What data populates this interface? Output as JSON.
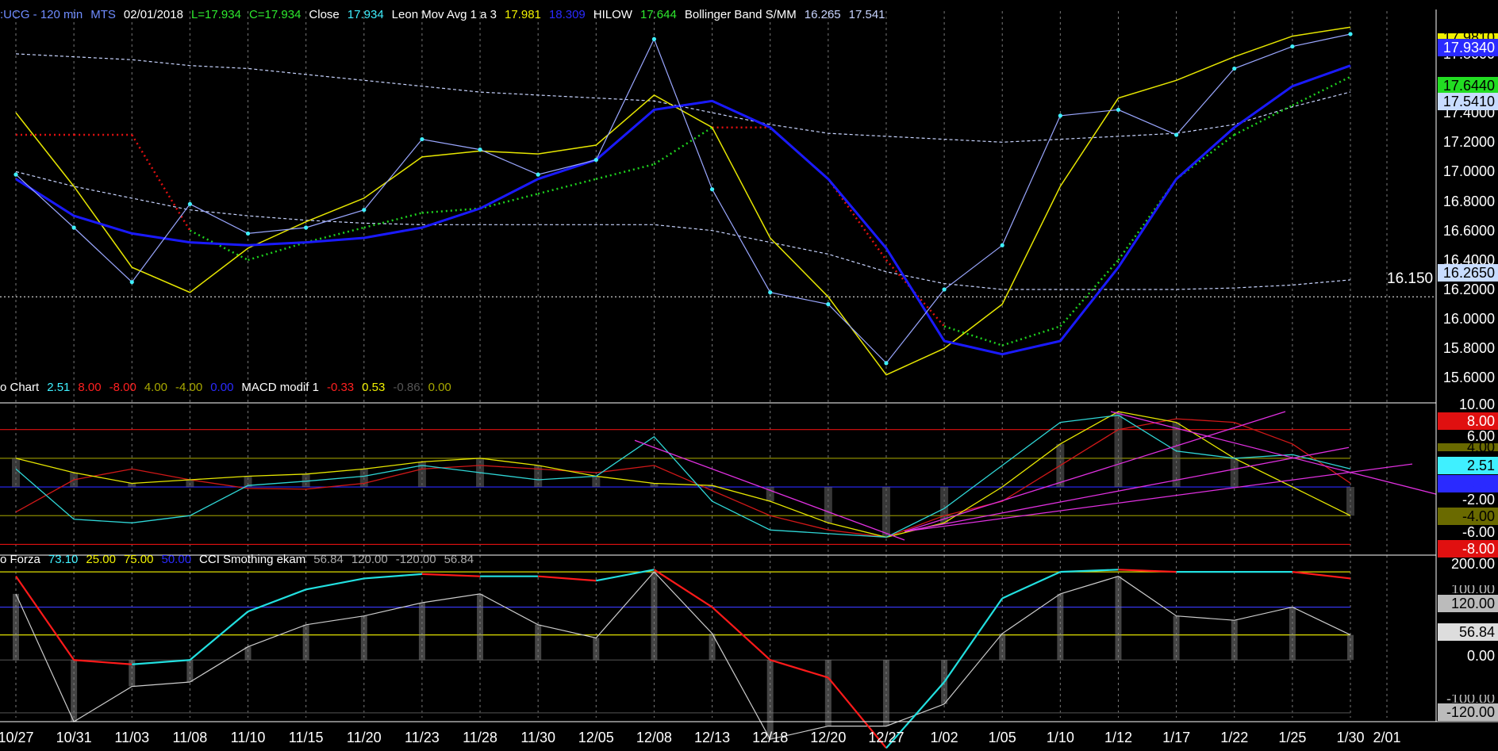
{
  "header_main": {
    "symbol": ":UCG - 120 min",
    "source": "MTS",
    "date": "02/01/2018",
    "low": "L=17.934",
    "close_eq": "C=17.934",
    "close_label": "Close",
    "close_value": "17.934",
    "mov_avg_label": "Leon Mov Avg 1 a 3",
    "mov_avg_v1": "17.981",
    "mov_avg_v2": "18.309",
    "hilow_label": "HILOW",
    "hilow_value": "17.644",
    "bb_label": "Bollinger Band S/MM",
    "bb_v1": "16.265",
    "bb_v2": "17.541"
  },
  "header_macd": {
    "chart_label": "o Chart",
    "v1": "2.51",
    "v2": "8.00",
    "v3": "-8.00",
    "v4": "4.00",
    "v5": "-4.00",
    "v6": "0.00",
    "macd_label": "MACD modif 1",
    "m1": "-0.33",
    "m2": "0.53",
    "m3": "-0.86",
    "m4": "0.00"
  },
  "header_cci": {
    "forza_label": "o Forza",
    "f1": "73.10",
    "f2": "25.00",
    "f3": "75.00",
    "f4": "50.00",
    "cci_label": "CCI Smothing ekam",
    "c1": "56.84",
    "c2": "120.00",
    "c3": "-120.00",
    "c4": "56.84"
  },
  "price_scale": {
    "ticks": [
      "17.8000",
      "17.6000",
      "17.4000",
      "17.2000",
      "17.0000",
      "16.8000",
      "16.6000",
      "16.4000",
      "16.2000",
      "16.0000",
      "15.8000",
      "15.6000"
    ],
    "top_tag": "17.9810",
    "close_tag": "17.9340",
    "hilow_tag": "17.6440",
    "bb_upper_tag": "17.5410",
    "bb_lower_tag": "16.2650",
    "ref_line_label": "16.150"
  },
  "macd_scale": {
    "ticks": [
      "10.00",
      "6.00",
      "-2.00",
      "-6.00"
    ],
    "tag_8": "8.00",
    "tag_4": "4.00",
    "tag_251": "2.51",
    "tag_0": "0.00",
    "tag_m4": "-4.00",
    "tag_m8": "-8.00"
  },
  "cci_scale": {
    "ticks": [
      "200.00",
      "0.00"
    ],
    "tag_120": "120.00",
    "tag_100": "100.00",
    "tag_5684": "56.84",
    "tag_m100": "-100.00",
    "tag_m120": "-120.00"
  },
  "x_axis": {
    "labels": [
      "10/27",
      "10/31",
      "11/03",
      "11/08",
      "11/10",
      "11/15",
      "11/20",
      "11/23",
      "11/28",
      "11/30",
      "12/05",
      "12/08",
      "12/13",
      "12/18",
      "12/20",
      "12/27",
      "1/02",
      "1/05",
      "1/10",
      "1/12",
      "1/17",
      "1/22",
      "1/25",
      "1/30",
      "2/01"
    ]
  },
  "colors": {
    "price_line": "#9aa7ff",
    "dots": "#3ff0ff",
    "ma_yellow": "#e6e600",
    "ma_blue": "#1a1aff",
    "hilow_green": "#1ed21e",
    "hilow_red": "#e01010",
    "bb": "#c8d4ff",
    "macd_cyan": "#2fd6d6",
    "trend_magenta": "#e030e0",
    "cci_red": "#ff1a1a",
    "cci_cyan": "#22e0e0"
  },
  "chart_data": [
    {
      "type": "line",
      "panel": "price",
      "x": [
        "10/27",
        "10/31",
        "11/03",
        "11/08",
        "11/10",
        "11/15",
        "11/20",
        "11/23",
        "11/28",
        "11/30",
        "12/05",
        "12/08",
        "12/13",
        "12/18",
        "12/20",
        "12/27",
        "1/02",
        "1/05",
        "1/10",
        "1/12",
        "1/17",
        "1/22",
        "1/25",
        "1/30"
      ],
      "series": [
        {
          "name": "Close",
          "values": [
            16.98,
            16.62,
            16.25,
            16.78,
            16.58,
            16.62,
            16.74,
            17.22,
            17.15,
            16.98,
            17.08,
            17.9,
            16.88,
            16.18,
            16.1,
            15.7,
            16.2,
            16.5,
            17.38,
            17.42,
            17.25,
            17.7,
            17.85,
            17.934
          ]
        },
        {
          "name": "Leon Mov Avg 1 a 3",
          "values": [
            17.4,
            16.9,
            16.35,
            16.18,
            16.48,
            16.66,
            16.82,
            17.1,
            17.14,
            17.12,
            17.18,
            17.52,
            17.3,
            16.55,
            16.15,
            15.62,
            15.8,
            16.1,
            16.9,
            17.5,
            17.62,
            17.78,
            17.92,
            17.981
          ]
        },
        {
          "name": "Bollinger Band S/MM",
          "values": [
            16.95,
            16.7,
            16.58,
            16.52,
            16.5,
            16.52,
            16.55,
            16.62,
            16.75,
            16.95,
            17.08,
            17.42,
            17.48,
            17.3,
            16.95,
            16.48,
            15.85,
            15.76,
            15.85,
            16.35,
            16.95,
            17.3,
            17.58,
            17.72
          ]
        },
        {
          "name": "HILOW",
          "values": [
            17.25,
            17.25,
            17.25,
            16.6,
            16.4,
            16.52,
            16.62,
            16.72,
            16.75,
            16.85,
            16.95,
            17.05,
            17.3,
            17.3,
            16.95,
            16.4,
            15.95,
            15.82,
            15.95,
            16.4,
            16.95,
            17.25,
            17.45,
            17.644
          ]
        },
        {
          "name": "BB upper",
          "values": [
            17.8,
            17.78,
            17.76,
            17.72,
            17.7,
            17.66,
            17.62,
            17.58,
            17.54,
            17.52,
            17.5,
            17.48,
            17.4,
            17.32,
            17.26,
            17.24,
            17.22,
            17.2,
            17.22,
            17.24,
            17.26,
            17.32,
            17.44,
            17.541
          ]
        },
        {
          "name": "BB lower",
          "values": [
            17.0,
            16.9,
            16.82,
            16.74,
            16.7,
            16.67,
            16.65,
            16.64,
            16.64,
            16.64,
            16.64,
            16.64,
            16.6,
            16.52,
            16.44,
            16.32,
            16.24,
            16.2,
            16.2,
            16.2,
            16.2,
            16.21,
            16.23,
            16.265
          ]
        }
      ],
      "ylim": [
        15.5,
        17.95
      ],
      "reference_line": 16.15
    },
    {
      "type": "line",
      "panel": "macd",
      "x": [
        "10/27",
        "10/31",
        "11/03",
        "11/08",
        "11/10",
        "11/15",
        "11/20",
        "11/23",
        "11/28",
        "11/30",
        "12/05",
        "12/08",
        "12/13",
        "12/18",
        "12/20",
        "12/27",
        "1/02",
        "1/05",
        "1/10",
        "1/12",
        "1/17",
        "1/22",
        "1/25",
        "1/30"
      ],
      "series": [
        {
          "name": "Chart",
          "values": [
            2.5,
            -4.5,
            -5.0,
            -4.0,
            0.2,
            0.8,
            1.5,
            3.0,
            2.0,
            1.0,
            1.5,
            7.0,
            -2.0,
            -6.0,
            -6.5,
            -7.0,
            -3.0,
            3.0,
            9.0,
            10.0,
            5.0,
            4.0,
            4.5,
            2.51
          ]
        },
        {
          "name": "MACD modif 1",
          "values": [
            -3.5,
            1.0,
            2.5,
            1.0,
            -0.2,
            -0.3,
            0.5,
            2.5,
            3.0,
            2.5,
            2.0,
            3.0,
            -0.5,
            -4.0,
            -6.0,
            -7.0,
            -4.0,
            -2.0,
            3.0,
            8.0,
            9.5,
            9.0,
            6.0,
            0.53
          ]
        },
        {
          "name": "signal",
          "values": [
            4.0,
            2.0,
            0.5,
            1.0,
            1.5,
            1.8,
            2.5,
            3.5,
            4.0,
            3.0,
            1.5,
            0.5,
            0.2,
            -2.0,
            -5.0,
            -7.0,
            -5.0,
            0.0,
            6.0,
            10.5,
            9.0,
            4.0,
            0.0,
            -4.0
          ]
        }
      ],
      "levels": [
        8,
        4,
        0,
        -4,
        -8
      ],
      "ylim": [
        -9.5,
        11.5
      ]
    },
    {
      "type": "line",
      "panel": "cci",
      "x": [
        "10/27",
        "10/31",
        "11/03",
        "11/08",
        "11/10",
        "11/15",
        "11/20",
        "11/23",
        "11/28",
        "11/30",
        "12/05",
        "12/08",
        "12/13",
        "12/18",
        "12/20",
        "12/27",
        "1/02",
        "1/05",
        "1/10",
        "1/12",
        "1/17",
        "1/22",
        "1/25",
        "1/30"
      ],
      "series": [
        {
          "name": "Forza",
          "values": [
            190,
            0,
            -10,
            0,
            110,
            160,
            185,
            195,
            190,
            190,
            180,
            205,
            120,
            0,
            -40,
            -200,
            -50,
            140,
            200,
            205,
            200,
            200,
            200,
            185
          ]
        },
        {
          "name": "CCI Smothing ekam",
          "values": [
            150,
            -140,
            -60,
            -50,
            30,
            80,
            100,
            130,
            150,
            80,
            50,
            200,
            60,
            -180,
            -150,
            -150,
            -100,
            60,
            150,
            190,
            100,
            90,
            120,
            56.84
          ]
        }
      ],
      "levels": [
        200,
        120,
        56.84,
        0,
        -120
      ],
      "ylim": [
        -140,
        220
      ]
    }
  ]
}
